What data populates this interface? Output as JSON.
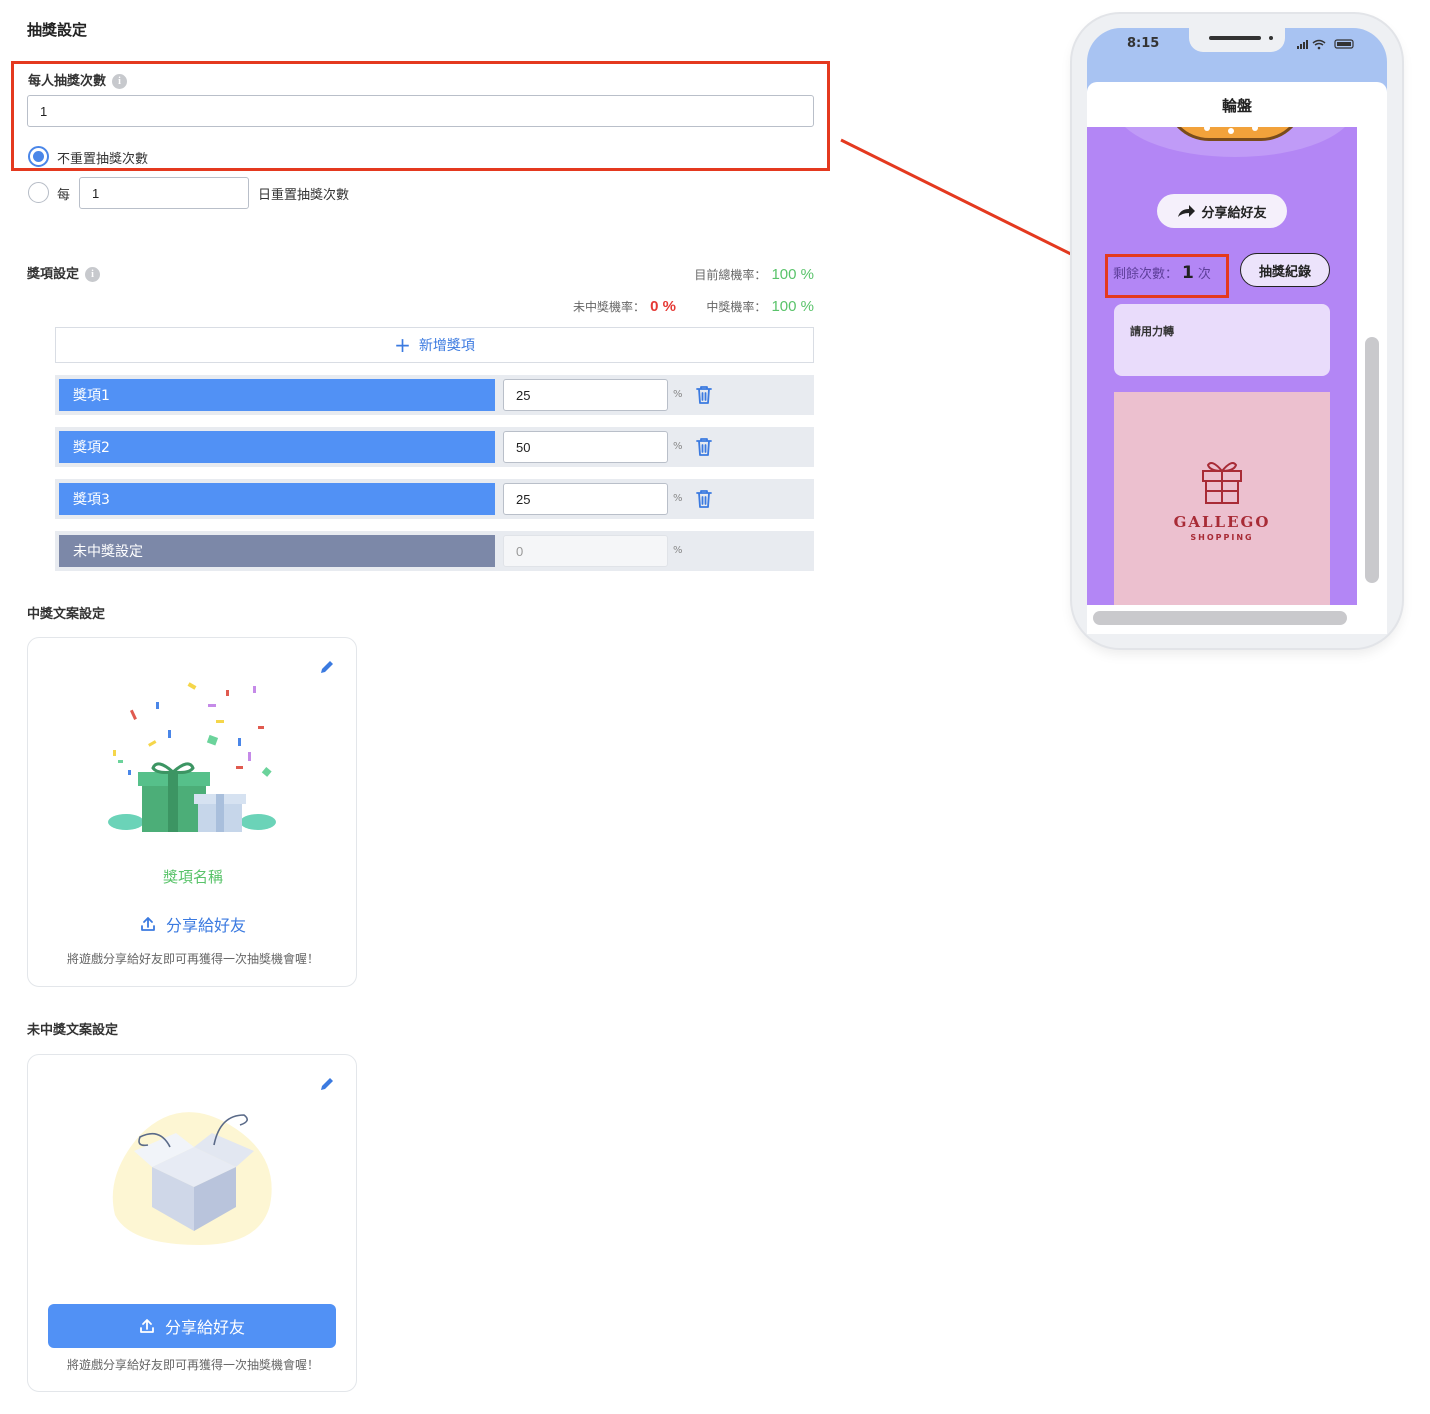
{
  "lottery_settings": {
    "title": "抽獎設定",
    "per_person_label": "每人抽獎次數",
    "per_person_value": "1",
    "no_reset_label": "不重置抽獎次數",
    "every_label": "每",
    "every_value": "1",
    "daily_reset_label": "日重置抽獎次數"
  },
  "prize_settings": {
    "title": "獎項設定",
    "total_prob_label": "目前總機率：",
    "total_prob_value": "100 %",
    "lose_prob_label": "未中獎機率：",
    "lose_prob_value": "0 %",
    "win_prob_label": "中獎機率：",
    "win_prob_value": "100 %",
    "add_label": "新增獎項",
    "items": [
      {
        "name": "獎項1",
        "value": "25"
      },
      {
        "name": "獎項2",
        "value": "50"
      },
      {
        "name": "獎項3",
        "value": "25"
      }
    ],
    "no_win": {
      "name": "未中獎設定",
      "placeholder": "0"
    },
    "pct_sign": "%"
  },
  "win_copy": {
    "title": "中獎文案設定",
    "prize_name": "獎項名稱",
    "share_label": "分享給好友",
    "note": "將遊戲分享給好友即可再獲得一次抽獎機會喔！"
  },
  "lose_copy": {
    "title": "未中獎文案設定",
    "share_label": "分享給好友",
    "note": "將遊戲分享給好友即可再獲得一次抽獎機會喔！"
  },
  "phone": {
    "time": "8:15",
    "page_title": "輪盤",
    "share_label": "分享給好友",
    "remaining_label": "剩餘次數：",
    "remaining_value": "1",
    "remaining_unit": "次",
    "history_label": "抽獎紀錄",
    "spin_hint": "請用力轉",
    "brand_name": "GALLEGO",
    "brand_sub": "SHOPPING"
  },
  "colors": {
    "accent_blue": "#5191f5",
    "highlight_red": "#e4391f",
    "purple_bg": "#b386f5",
    "green": "#59c36a"
  }
}
